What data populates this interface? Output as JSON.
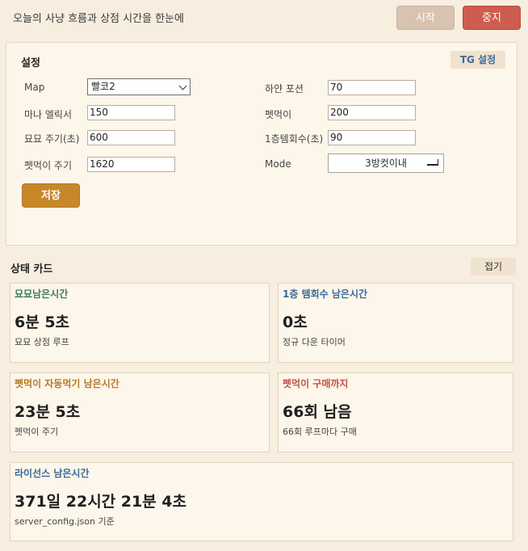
{
  "header": {
    "tagline": "오늘의 사냥 흐름과 상점 시간을 한눈에",
    "start_label": "시작",
    "stop_label": "중지"
  },
  "settings": {
    "title": "설정",
    "tg_label": "TG 설정",
    "map_label": "Map",
    "map_value": "빨코2",
    "white_potion_label": "하얀 포션",
    "white_potion_value": "70",
    "mana_elixir_label": "마나 엘릭서",
    "mana_elixir_value": "150",
    "pet_food_label": "펫먹이",
    "pet_food_value": "200",
    "myomyo_cycle_label": "묘묘 주기(초)",
    "myomyo_cycle_value": "600",
    "floor1_return_label": "1층템회수(초)",
    "floor1_return_value": "90",
    "pet_food_cycle_label": "펫먹이 주기",
    "pet_food_cycle_value": "1620",
    "mode_label": "Mode",
    "mode_value": "3방컷이내",
    "save_label": "저장"
  },
  "status": {
    "title": "상태 카드",
    "fold_label": "접기",
    "cards": [
      {
        "title": "묘묘남은시간",
        "value": "6분 5초",
        "sub": "묘묘 상점 루프",
        "color": "#3f7d5a"
      },
      {
        "title": "1층 템회수 남은시간",
        "value": "0초",
        "sub": "정규 다운 타이머",
        "color": "#3a6a9a"
      },
      {
        "title": "펫먹이 자동먹기 남은시간",
        "value": "23분 5초",
        "sub": "펫먹이 주기",
        "color": "#b57a25"
      },
      {
        "title": "펫먹이 구매까지",
        "value": "66회 남음",
        "sub": "66회 루프마다 구매",
        "color": "#c0534a"
      },
      {
        "title": "라이선스 남은시간",
        "value": "371일 22시간 21분 4초",
        "sub": "server_config.json 기준",
        "color": "#3a6a9a"
      }
    ]
  }
}
